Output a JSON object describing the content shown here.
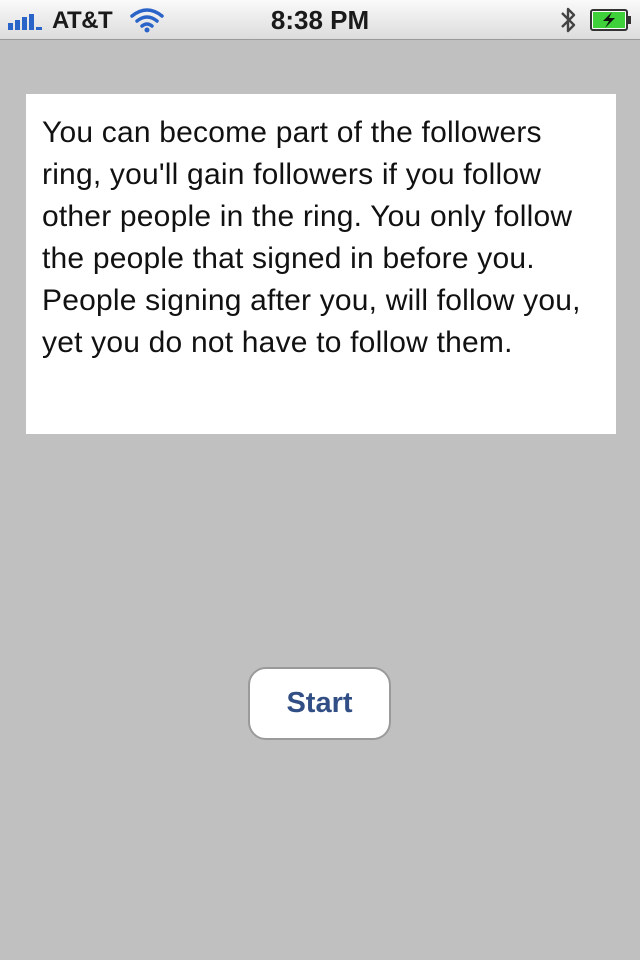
{
  "status_bar": {
    "carrier": "AT&T",
    "time": "8:38 PM",
    "icons": {
      "signal": "signal-bars-icon",
      "wifi": "wifi-icon",
      "bluetooth": "bluetooth-icon",
      "battery": "battery-charging-icon"
    },
    "signal_bars": 4,
    "battery_level": 1.0,
    "battery_color": "#3fd13a"
  },
  "info_panel": {
    "text": "You can become part of the followers ring, you'll gain followers if you follow other people in the ring. You only follow the people that signed in before you. People signing after you, will follow you, yet you do not have to follow them."
  },
  "start_button": {
    "label": "Start",
    "color": "#324f85"
  },
  "colors": {
    "background": "#c0c0c0",
    "panel": "#ffffff"
  }
}
